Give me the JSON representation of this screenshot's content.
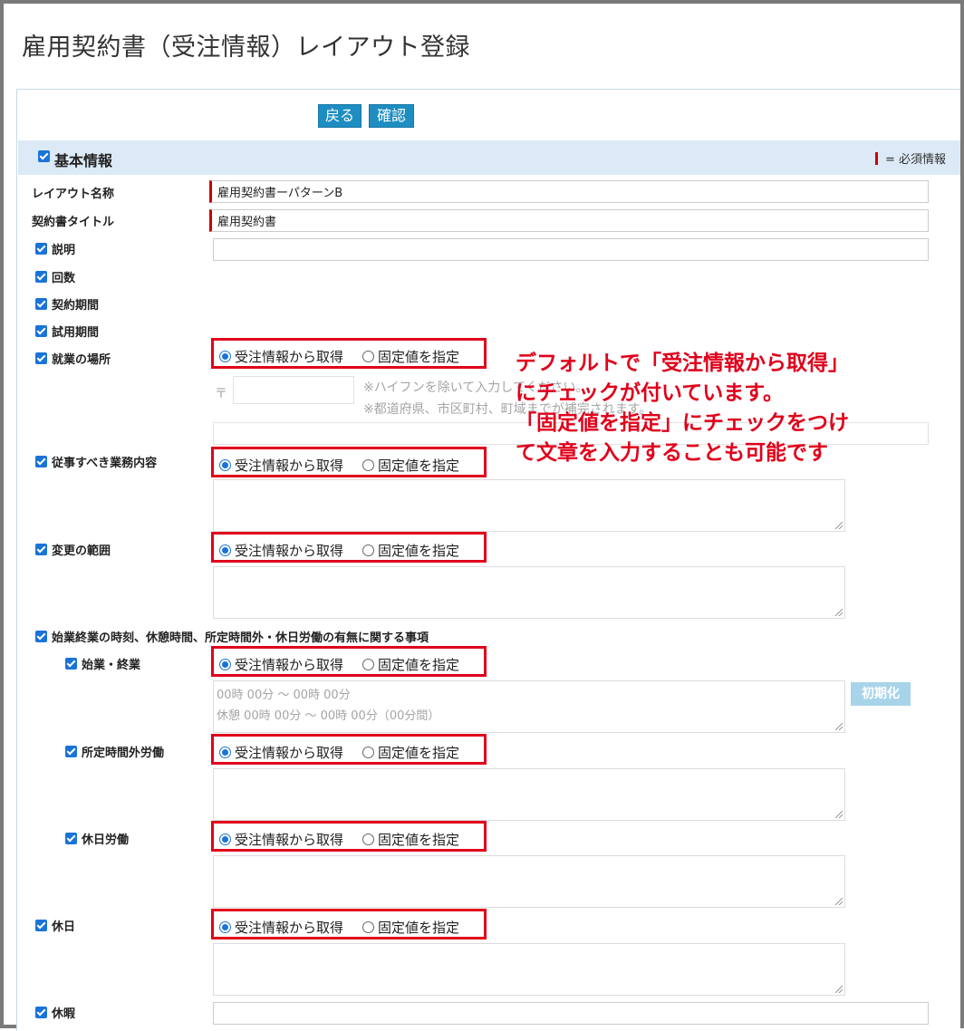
{
  "page": {
    "title": "雇用契約書（受注情報）レイアウト登録"
  },
  "toolbar": {
    "back_label": "戻る",
    "confirm_label": "確認"
  },
  "section": {
    "title": "基本情報",
    "required_legend": "= 必須情報"
  },
  "fields": {
    "layout_name": {
      "label": "レイアウト名称",
      "value": "雇用契約書ーパターンB"
    },
    "contract_title": {
      "label": "契約書タイトル",
      "value": "雇用契約書"
    },
    "description": {
      "label": "説明",
      "value": ""
    },
    "count": {
      "label": "回数"
    },
    "contract_period": {
      "label": "契約期間"
    },
    "trial_period": {
      "label": "試用期間"
    },
    "workplace": {
      "label": "就業の場所",
      "postal_mark": "〒",
      "postal_hint": "※ハイフンを除いて入力してください。",
      "address_hint": "※都道府県、市区町村、町域までが補完されます。"
    },
    "job_content": {
      "label": "従事すべき業務内容"
    },
    "change_scope": {
      "label": "変更の範囲"
    },
    "working_hours_group": {
      "label": "始業終業の時刻、休憩時間、所定時間外・休日労働の有無に関する事項"
    },
    "start_end": {
      "label": "始業・終業",
      "placeholder_line1": "00時 00分 ～ 00時 00分",
      "placeholder_line2": "休憩 00時 00分 ～ 00時 00分（00分間）",
      "reset_label": "初期化"
    },
    "overtime": {
      "label": "所定時間外労働"
    },
    "holiday_work": {
      "label": "休日労働"
    },
    "holidays": {
      "label": "休日"
    },
    "leave": {
      "label": "休暇"
    }
  },
  "radio": {
    "from_order": "受注情報から取得",
    "fixed_value": "固定値を指定"
  },
  "callout": {
    "line1": "デフォルトで「受注情報から取得」",
    "line2": "にチェックが付いています。",
    "line3": "「固定値を指定」にチェックをつけ",
    "line4": "て文章を入力することも可能です"
  },
  "colors": {
    "accent": "#1e8dc1",
    "highlight": "#e0001b",
    "section_bg": "#dbeaf6"
  }
}
